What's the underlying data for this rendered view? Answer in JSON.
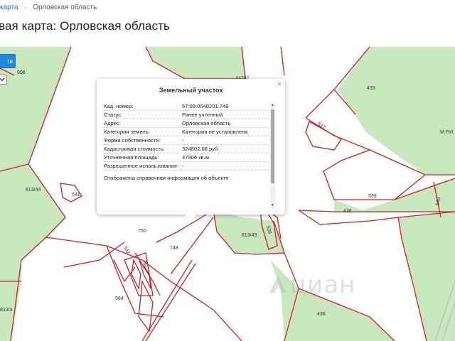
{
  "breadcrumb": {
    "link": "карта",
    "separator": "›",
    "current": "Орловская область"
  },
  "page_title": "вая карта: Орловская область",
  "toolbar": {
    "find_label": "ти",
    "select_icon": "chevron-down-icon"
  },
  "map": {
    "land_color": "#c9e8c0",
    "border_color": "#d02020",
    "labels": {
      "l906": "906",
      "l817": "817/47",
      "l433": "433",
      "l537": "537",
      "lmri": "М.Р.И.",
      "l541": "541",
      "l813_44": "813/44",
      "l539": "539",
      "l540": "540",
      "l436a": "436",
      "l750": "750",
      "l538": "538",
      "l813_43": "813/43",
      "l542": "542",
      "l748": "748",
      "l544": "544",
      "l584": "584",
      "l436b": "436",
      "l813_4": "813/4"
    }
  },
  "watermark": {
    "text": "циан",
    "icon": "cian-logo-icon"
  },
  "popup": {
    "title": "Земельный участок",
    "close_icon": "close-icon",
    "close_label": "×",
    "rows": [
      {
        "label": "Кад. номер:",
        "value": "57:09:0040201:748"
      },
      {
        "label": "Статус:",
        "value": "Ранее учтенный"
      },
      {
        "label": "Адрес:",
        "value": "Орловская область"
      },
      {
        "label": "Категория земель:",
        "value": "Категория не установлена"
      },
      {
        "label": "Форма собственности:",
        "value": "-"
      },
      {
        "label": "Кадастровая стоимость:",
        "value": "324802.68 руб"
      },
      {
        "label": "Уточненная площадь:",
        "value": "47906 кв.м"
      },
      {
        "label": "Разрешенное использование:",
        "value": "-"
      },
      {
        "label": "Отображена справочная информация об объекте",
        "value": ""
      }
    ],
    "scroll_up_label": "▲",
    "scroll_down_label": "▼"
  }
}
